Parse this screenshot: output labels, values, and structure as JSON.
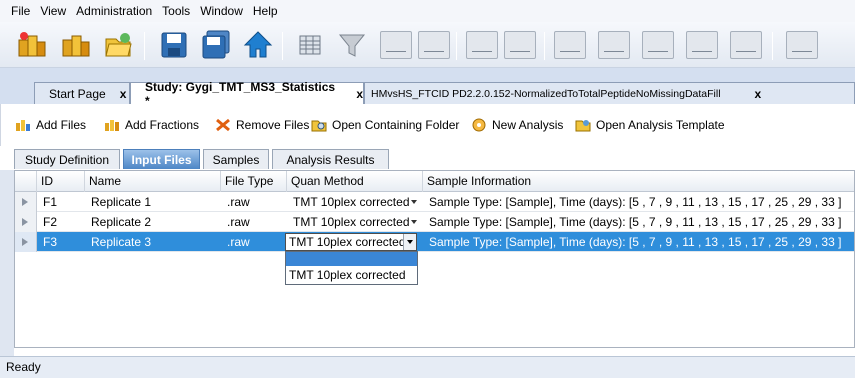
{
  "menu": [
    "File",
    "View",
    "Administration",
    "Tools",
    "Window",
    "Help"
  ],
  "doc_tabs": [
    {
      "label": "Start Page",
      "close": "x"
    },
    {
      "label": "Study: Gygi_TMT_MS3_Statistics *",
      "close": "x"
    },
    {
      "label": "HMvsHS_FTCID PD2.2.0.152-NormalizedToTotalPeptideNoMissingDataFill",
      "close": "x"
    }
  ],
  "commands": [
    "Add Files",
    "Add Fractions",
    "Remove Files",
    "Open Containing Folder",
    "New Analysis",
    "Open Analysis Template"
  ],
  "sub_tabs": [
    "Study Definition",
    "Input Files",
    "Samples",
    "Analysis Results"
  ],
  "grid": {
    "headers": [
      "ID",
      "Name",
      "File Type",
      "Quan Method",
      "Sample Information"
    ],
    "rows": [
      {
        "id": "F1",
        "name": "Replicate 1",
        "type": ".raw",
        "quan": "TMT 10plex corrected",
        "info": "Sample Type: [Sample], Time (days): [5 , 7 , 9 , 11 , 13 , 15 , 17 , 25 , 29 , 33 ]"
      },
      {
        "id": "F2",
        "name": "Replicate 2",
        "type": ".raw",
        "quan": "TMT 10plex corrected",
        "info": "Sample Type: [Sample], Time (days): [5 , 7 , 9 , 11 , 13 , 15 , 17 , 25 , 29 , 33 ]"
      },
      {
        "id": "F3",
        "name": "Replicate 3",
        "type": ".raw",
        "quan": "TMT 10plex corrected",
        "info": "Sample Type: [Sample], Time (days): [5 , 7 , 9 , 11 , 13 , 15 , 17 , 25 , 29 , 33 ]"
      }
    ]
  },
  "dropdown_option": "TMT 10plex corrected",
  "status": "Ready",
  "colors": {
    "selection": "#2f8edb",
    "tab_active": "#4d86c6",
    "toolbar_bg": "#e3e9f2"
  }
}
